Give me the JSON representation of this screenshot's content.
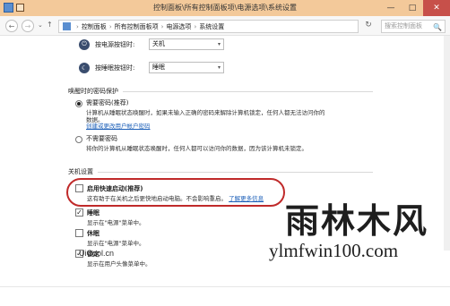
{
  "window": {
    "title": "控制面板\\所有控制面板项\\电源选项\\系统设置",
    "minimize_glyph": "—",
    "maximize_glyph": "□",
    "close_glyph": "✕"
  },
  "nav": {
    "back_glyph": "←",
    "forward_glyph": "→",
    "dropdown_glyph": "⌄",
    "up_glyph": "↑",
    "refresh_glyph": "↻"
  },
  "breadcrumb": [
    {
      "label": "控制面板"
    },
    {
      "label": "所有控制面板项"
    },
    {
      "label": "电源选项"
    },
    {
      "label": "系统设置"
    }
  ],
  "breadcrumb_separator": "›",
  "search": {
    "placeholder": "搜索控制面板",
    "icon_glyph": "🔍"
  },
  "power_buttons": {
    "power_label": "按电源按钮时:",
    "power_value": "关机",
    "sleep_label": "按睡眠按钮时:",
    "sleep_value": "睡眠",
    "power_icon_glyph": "⏻",
    "sleep_icon_glyph": "☾",
    "arrow_glyph": "▾"
  },
  "password_section": {
    "heading": "唤醒时的密码保护",
    "option1_title": "需要密码(推荐)",
    "option1_desc": "计算机从睡眠状态唤醒时，如果未输入正确的密码来解除计算机锁定，任何人都无法访问你的",
    "option1_desc2": "数据。",
    "option1_link": "创建或更改用户帐户密码",
    "option2_title": "不需要密码",
    "option2_desc": "将你的计算机从睡眠状态唤醒时，任何人都可以访问你的数据，因为该计算机未锁定。"
  },
  "shutdown_section": {
    "heading": "关机设置",
    "fast_startup_title": "启用快速启动(推荐)",
    "fast_startup_desc": "这有助于在关机之后更快地启动电脑。不会影响重启。",
    "fast_startup_link": "了解更多信息",
    "sleep_title": "睡眠",
    "sleep_desc": "显示在\"电源\"菜单中。",
    "hibernate_title": "休眠",
    "hibernate_desc": "显示在\"电源\"菜单中。",
    "lock_title": "锁定",
    "lock_desc": "显示在用户头像菜单中。",
    "check_glyph": "✓"
  },
  "watermark": {
    "site": "UiCool.cn",
    "brand": "雨林木风",
    "url": "ylmfwin100.com"
  }
}
